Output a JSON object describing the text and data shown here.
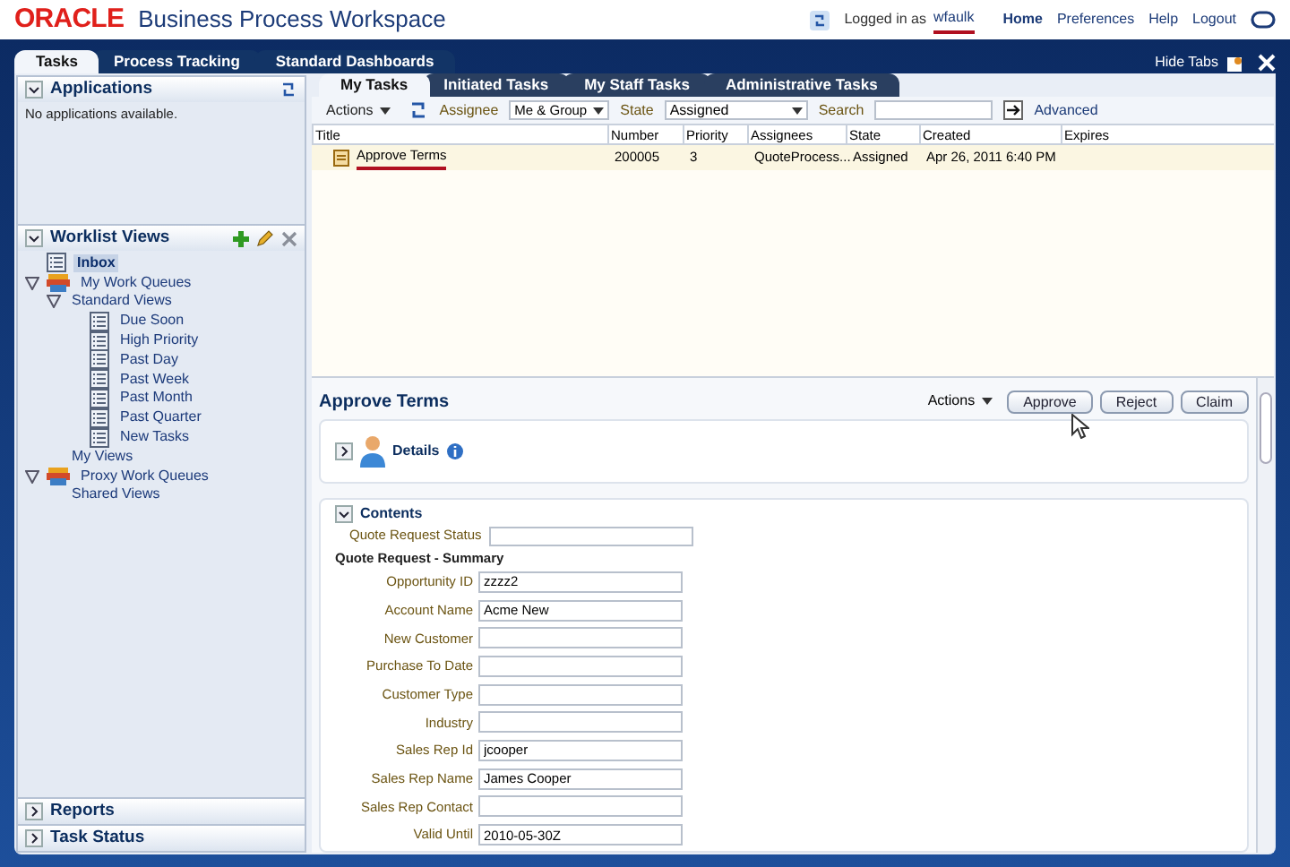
{
  "header": {
    "brand": "ORACLE",
    "title": "Business Process Workspace",
    "login_label": "Logged in as",
    "user": "wfaulk",
    "links": [
      "Home",
      "Preferences",
      "Help",
      "Logout"
    ]
  },
  "main_tabs": [
    {
      "label": "Tasks",
      "selected": true
    },
    {
      "label": "Process Tracking",
      "selected": false
    },
    {
      "label": "Standard Dashboards",
      "selected": false
    }
  ],
  "hide_tabs": "Hide Tabs",
  "applications": {
    "title": "Applications",
    "empty": "No applications available."
  },
  "worklist_views": {
    "title": "Worklist Views",
    "tree": [
      {
        "label": "Inbox",
        "kind": "view",
        "selected": true
      },
      {
        "label": "My Work Queues",
        "kind": "queue",
        "selected": false,
        "expanded": true,
        "children": [
          {
            "label": "Standard Views",
            "selected": false,
            "expanded": true,
            "children": [
              {
                "label": "Due Soon",
                "kind": "view",
                "selected": false
              },
              {
                "label": "High Priority",
                "kind": "view",
                "selected": false
              },
              {
                "label": "Past Day",
                "kind": "view",
                "selected": false
              },
              {
                "label": "Past Week",
                "kind": "view",
                "selected": false
              },
              {
                "label": "Past Month",
                "kind": "view",
                "selected": false
              },
              {
                "label": "Past Quarter",
                "kind": "view",
                "selected": false
              },
              {
                "label": "New Tasks",
                "kind": "view",
                "selected": false
              }
            ]
          },
          {
            "label": "My Views",
            "selected": false
          }
        ]
      },
      {
        "label": "Proxy Work Queues",
        "kind": "queue",
        "selected": false,
        "expanded": true,
        "children": [
          {
            "label": "Shared Views",
            "selected": false
          }
        ]
      }
    ]
  },
  "bottom_panels": [
    "Reports",
    "Task Status"
  ],
  "task_tabs": [
    {
      "label": "My Tasks",
      "selected": true
    },
    {
      "label": "Initiated Tasks",
      "selected": false
    },
    {
      "label": "My Staff Tasks",
      "selected": false
    },
    {
      "label": "Administrative Tasks",
      "selected": false
    }
  ],
  "toolbar": {
    "actions": "Actions",
    "assignee_label": "Assignee",
    "assignee": "Me & Group",
    "state_label": "State",
    "state": "Assigned",
    "search_label": "Search",
    "advanced": "Advanced"
  },
  "table": {
    "columns": [
      "Title",
      "Number",
      "Priority",
      "Assignees",
      "State",
      "Created",
      "Expires"
    ],
    "rows": [
      {
        "cells": [
          "Approve Terms",
          "200005",
          "3",
          "QuoteProcess...",
          "Assigned",
          "Apr 26, 2011 6:40 PM",
          ""
        ],
        "selected": false
      }
    ]
  },
  "detail": {
    "title": "Approve Terms",
    "actions": "Actions",
    "buttons": [
      "Approve",
      "Reject",
      "Claim"
    ],
    "details": "Details",
    "contents": "Contents",
    "status_field": {
      "label": "Quote Request Status"
    },
    "section": "Quote Request - Summary",
    "fields": [
      {
        "label": "Opportunity ID",
        "value": "zzzz2"
      },
      {
        "label": "Account Name",
        "value": "Acme New"
      },
      {
        "label": "New Customer"
      },
      {
        "label": "Purchase To Date"
      },
      {
        "label": "Customer Type"
      },
      {
        "label": "Industry"
      },
      {
        "label": "Sales Rep Id",
        "value": "jcooper"
      },
      {
        "label": "Sales Rep Name",
        "value": "James Cooper"
      },
      {
        "label": "Sales Rep Contact"
      },
      {
        "label": "Valid Until",
        "value": "2010-05-30Z"
      }
    ]
  }
}
